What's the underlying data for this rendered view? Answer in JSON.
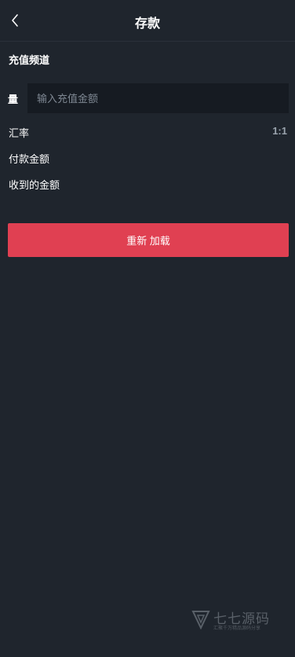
{
  "header": {
    "title": "存款",
    "back_icon": "chevron-left-icon"
  },
  "deposit": {
    "channel_heading": "充值频道",
    "amount_label": "量",
    "amount_placeholder": "输入充值金额",
    "amount_value": "",
    "exchange_rate_label": "汇率",
    "exchange_rate_value": "1:1",
    "payment_amount_label": "付款金额",
    "received_amount_label": "收到的金额",
    "reload_button_label": "重新 加载"
  },
  "watermark": {
    "title": "七七源码",
    "subtitle": "汇聚千万精品源码分享"
  },
  "colors": {
    "background": "#1f252d",
    "input_background": "#161b22",
    "accent": "#e04052",
    "muted_text": "#9aa3ad"
  }
}
